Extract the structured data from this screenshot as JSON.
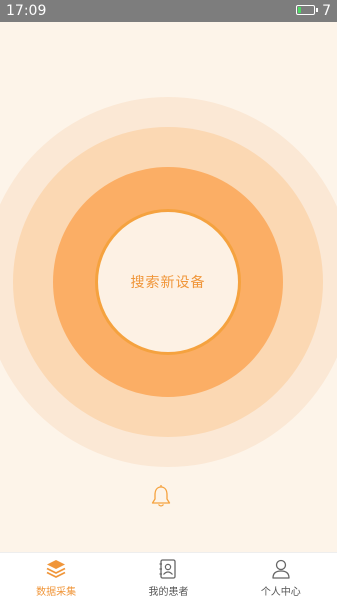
{
  "status_bar": {
    "time": "17:09",
    "battery_level": "7"
  },
  "main": {
    "search_label": "搜索新设备"
  },
  "tabs": [
    {
      "label": "数据采集",
      "icon": "layers-icon",
      "active": true
    },
    {
      "label": "我的患者",
      "icon": "contact-card-icon",
      "active": false
    },
    {
      "label": "个人中心",
      "icon": "person-icon",
      "active": false
    }
  ],
  "colors": {
    "accent": "#f0963a",
    "status_bar": "#7d7d7d"
  }
}
